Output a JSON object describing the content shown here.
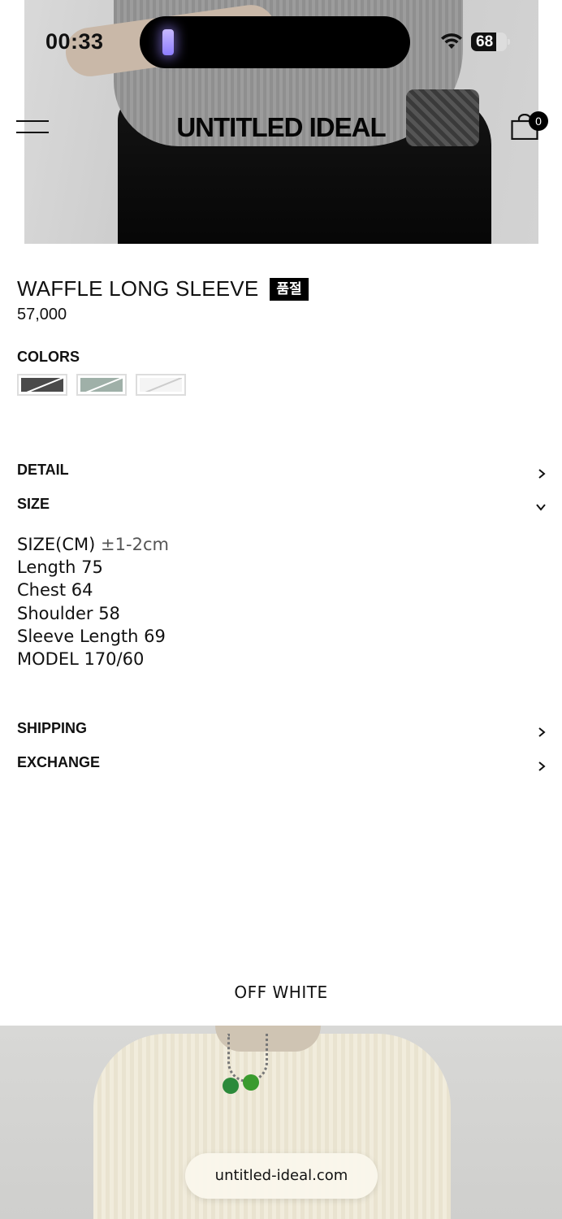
{
  "status_bar": {
    "time": "00:33",
    "battery": "68"
  },
  "header": {
    "logo": "UNTITLED IDEAL",
    "cart_count": "0"
  },
  "product": {
    "title": "WAFFLE LONG SLEEVE",
    "badge": "품절",
    "price": "57,000",
    "colors_label": "COLORS",
    "colors": [
      {
        "name": "charcoal",
        "hex": "#4a4a4a"
      },
      {
        "name": "sage",
        "hex": "#9fb0a8"
      },
      {
        "name": "off-white",
        "hex": "#f4f4f4"
      }
    ]
  },
  "accordion": {
    "detail": "DETAIL",
    "size": "SIZE",
    "shipping": "SHIPPING",
    "exchange": "EXCHANGE"
  },
  "size_info": {
    "heading": "SIZE(CM)",
    "tolerance": "±1-2cm",
    "lines": [
      "Length 75",
      "Chest 64",
      "Shoulder 58",
      "Sleeve Length 69",
      "MODEL 170/60"
    ]
  },
  "variant_label": "OFF WHITE",
  "browser": {
    "url": "untitled-ideal.com"
  }
}
